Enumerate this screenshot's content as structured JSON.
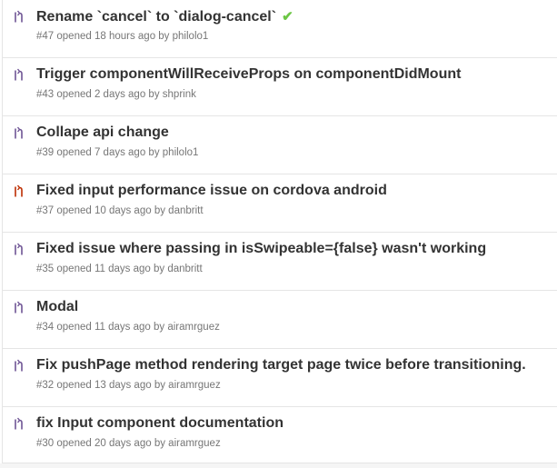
{
  "colors": {
    "open_pr_icon": "#6e5494",
    "closed_pr_icon": "#bd2c00",
    "check": "#6cc644",
    "title": "#333333",
    "meta": "#767676",
    "border": "#e5e5e5"
  },
  "pull_requests": [
    {
      "title": "Rename `cancel` to `dialog-cancel`",
      "number": "#47",
      "opened": "opened 18 hours ago by",
      "author": "philolo1",
      "status_icon": "check-icon",
      "icon": "git-pull-request-icon",
      "state": "open"
    },
    {
      "title": "Trigger componentWillReceiveProps on componentDidMount",
      "number": "#43",
      "opened": "opened 2 days ago by",
      "author": "shprink",
      "icon": "git-pull-request-icon",
      "state": "open"
    },
    {
      "title": "Collape api change",
      "number": "#39",
      "opened": "opened 7 days ago by",
      "author": "philolo1",
      "icon": "git-pull-request-icon",
      "state": "open"
    },
    {
      "title": "Fixed input performance issue on cordova android",
      "number": "#37",
      "opened": "opened 10 days ago by",
      "author": "danbritt",
      "icon": "git-pull-request-icon",
      "state": "closed"
    },
    {
      "title": "Fixed issue where passing in isSwipeable={false} wasn't working",
      "number": "#35",
      "opened": "opened 11 days ago by",
      "author": "danbritt",
      "icon": "git-pull-request-icon",
      "state": "open"
    },
    {
      "title": "Modal",
      "number": "#34",
      "opened": "opened 11 days ago by",
      "author": "airamrguez",
      "icon": "git-pull-request-icon",
      "state": "open"
    },
    {
      "title": "Fix pushPage method rendering target page twice before transitioning.",
      "number": "#32",
      "opened": "opened 13 days ago by",
      "author": "airamrguez",
      "icon": "git-pull-request-icon",
      "state": "open"
    },
    {
      "title": "fix Input component documentation",
      "number": "#30",
      "opened": "opened 20 days ago by",
      "author": "airamrguez",
      "icon": "git-pull-request-icon",
      "state": "open"
    }
  ]
}
